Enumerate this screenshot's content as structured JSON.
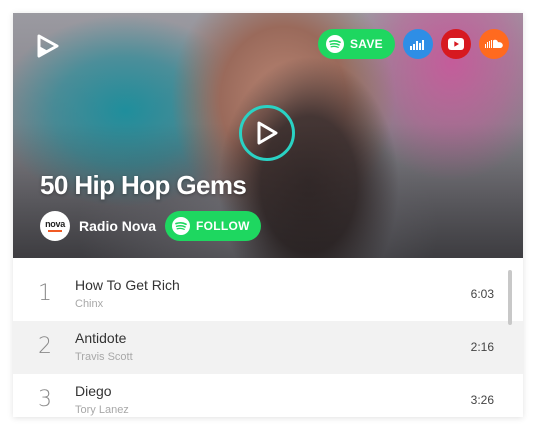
{
  "playlist": {
    "title": "50 Hip Hop Gems",
    "owner": "Radio Nova",
    "owner_logo_text": "nova"
  },
  "actions": {
    "save_label": "SAVE",
    "follow_label": "FOLLOW",
    "services": [
      "deezer-icon",
      "youtube-icon",
      "soundcloud-icon"
    ]
  },
  "colors": {
    "spotify_green": "#1ed760",
    "deezer_blue": "#2e8ee6",
    "youtube_red": "#d71920",
    "soundcloud_orange": "#ff6a1f",
    "play_ring": "#2ad2c4"
  },
  "tracks": [
    {
      "num": "1",
      "title": "How To Get Rich",
      "artist": "Chinx",
      "duration": "6:03"
    },
    {
      "num": "2",
      "title": "Antidote",
      "artist": "Travis Scott",
      "duration": "2:16"
    },
    {
      "num": "3",
      "title": "Diego",
      "artist": "Tory Lanez",
      "duration": "3:26"
    }
  ]
}
